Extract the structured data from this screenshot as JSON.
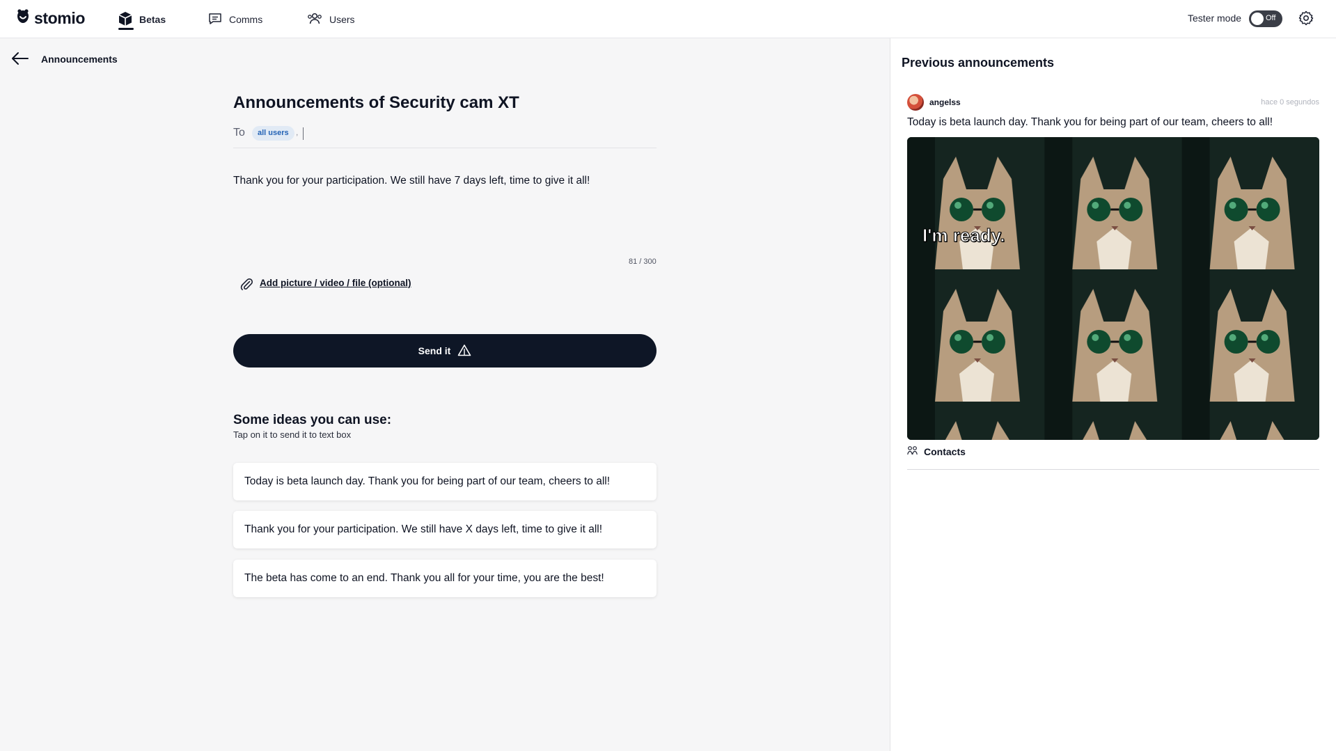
{
  "app": {
    "brand": "stomio"
  },
  "nav": {
    "items": [
      {
        "label": "Betas",
        "icon": "box-icon",
        "active": true
      },
      {
        "label": "Comms",
        "icon": "chat-icon",
        "active": false
      },
      {
        "label": "Users",
        "icon": "users-icon",
        "active": false
      }
    ]
  },
  "header": {
    "tester_mode_label": "Tester mode",
    "tester_mode_state": "Off"
  },
  "breadcrumb": {
    "label": "Announcements"
  },
  "composer": {
    "title": "Announcements of Security cam XT",
    "to_label": "To",
    "recipient_chip": "all users",
    "recipient_separator": ",",
    "message": "Thank you for your participation. We still have 7 days left, time to give it all!",
    "counter": "81 / 300",
    "attach_label": "Add picture / video / file (optional)",
    "send_label": "Send it"
  },
  "ideas": {
    "title": "Some ideas you can use:",
    "subtitle": "Tap on it to send it to text box",
    "items": [
      "Today is beta launch day. Thank you for being part of our team, cheers to all!",
      "Thank you for your participation. We still have X days left, time to give it all!",
      "The beta has come to an end. Thank you all for your time, you are the best!"
    ]
  },
  "previous": {
    "title": "Previous announcements",
    "announcements": [
      {
        "author": "angelss",
        "time": "hace 0 segundos",
        "text": "Today is beta launch day. Thank you for being part of our team, cheers to all!",
        "image_caption": "I'm ready.",
        "audience_label": "Contacts"
      }
    ]
  },
  "colors": {
    "primary": "#0e1626",
    "chip_bg": "#e1eaf5",
    "chip_text": "#2463b5",
    "background": "#f6f6f7"
  }
}
